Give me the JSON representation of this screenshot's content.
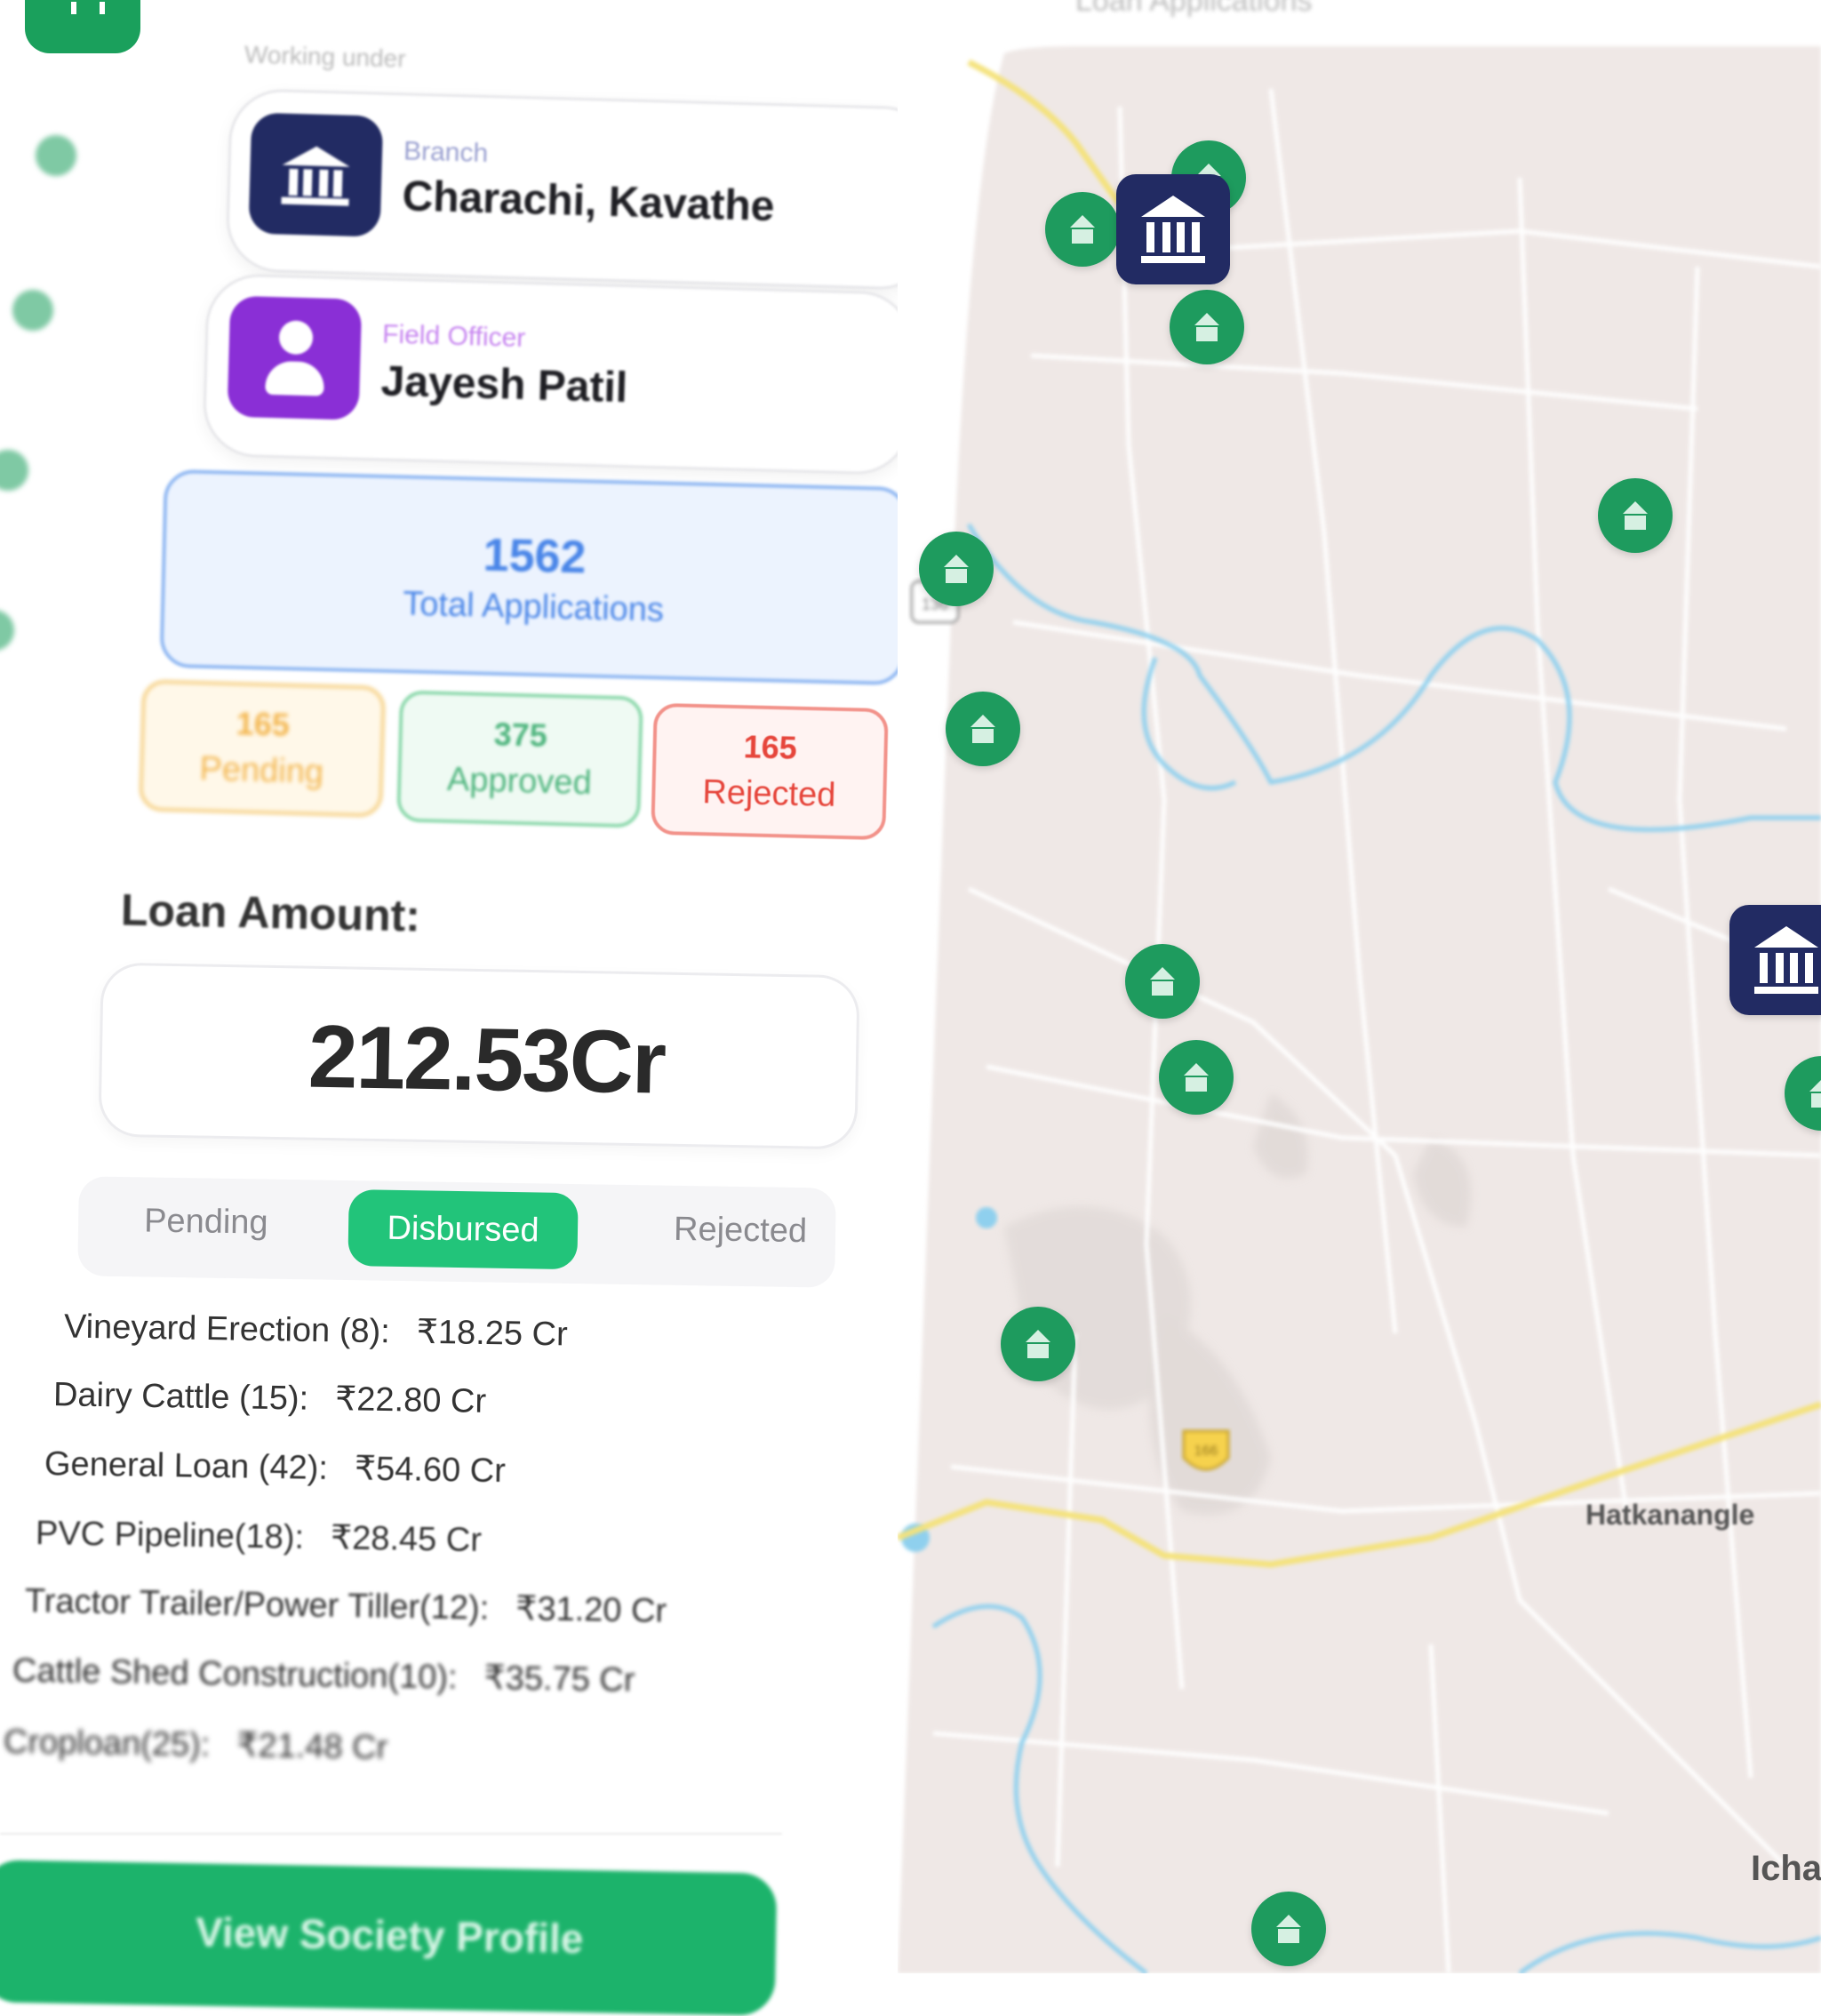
{
  "colors": {
    "brand_green": "#1aa05c",
    "bank_navy": "#222b63",
    "officer_purple": "#8a2fd6",
    "total_blue": "#4a86e8",
    "pending_amber": "#f3b64f",
    "approved_green": "#4fb57e",
    "rejected_red": "#e6453b",
    "active_tab": "#22c47a",
    "map_land": "#efe8e6",
    "map_water": "#8fd0ee",
    "map_highway": "#f4e27a"
  },
  "sidebar": {
    "icons": [
      "logo-icon",
      "nav-icon-1",
      "nav-icon-2",
      "nav-icon-3",
      "nav-icon-4"
    ]
  },
  "panel": {
    "working_under": "Working under",
    "branch": {
      "label": "Branch",
      "name": "Charachi, Kavathe",
      "icon": "bank-icon"
    },
    "officer": {
      "label": "Field Officer",
      "name": "Jayesh Patil",
      "icon": "person-icon"
    },
    "total": {
      "count": "1562",
      "label": "Total Applications"
    },
    "stats": {
      "pending": {
        "count": "165",
        "label": "Pending"
      },
      "approved": {
        "count": "375",
        "label": "Approved"
      },
      "rejected": {
        "count": "165",
        "label": "Rejected"
      }
    },
    "loan_amount_title": "Loan Amount:",
    "loan_amount_value": "212.53Cr",
    "tabs": {
      "pending": "Pending",
      "disbursed": "Disbursed",
      "rejected": "Rejected",
      "selected": "Disbursed"
    },
    "loans": [
      {
        "label": "Vineyard Erection (8):",
        "amount": "₹18.25 Cr"
      },
      {
        "label": "Dairy Cattle (15):",
        "amount": "₹22.80 Cr"
      },
      {
        "label": "General Loan (42):",
        "amount": "₹54.60 Cr"
      },
      {
        "label": "PVC Pipeline(18):",
        "amount": "₹28.45 Cr"
      },
      {
        "label": "Tractor Trailer/Power Tiller(12):",
        "amount": "₹31.20 Cr"
      },
      {
        "label": "Cattle Shed Construction(10):",
        "amount": "₹35.75 Cr"
      },
      {
        "label": "Croploan(25):",
        "amount": "₹21.48 Cr"
      }
    ],
    "cta_label": "View Society Profile"
  },
  "map": {
    "title": "Loan Applications",
    "places": {
      "hatkanangle": "Hatkanangle",
      "ichal": "Ichal"
    },
    "road_badges": [
      "136",
      "166"
    ],
    "pin_icon": "society-pin-icon",
    "branch_pin_icon": "bank-pin-icon"
  }
}
